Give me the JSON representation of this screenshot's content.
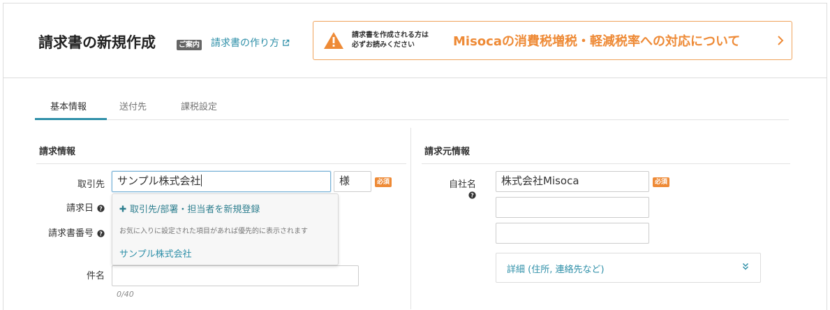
{
  "header": {
    "title": "請求書の新規作成",
    "guide_badge": "ご案内",
    "howto_link": "請求書の作り方",
    "notice_small_line1": "請求書を作成される方は",
    "notice_small_line2": "必ずお読みください",
    "notice_big": "Misocaの消費税増税・軽減税率への対応について"
  },
  "tabs": [
    {
      "label": "基本情報",
      "active": true
    },
    {
      "label": "送付先",
      "active": false
    },
    {
      "label": "課税設定",
      "active": false
    }
  ],
  "billing": {
    "section_title": "請求情報",
    "client_label": "取引先",
    "client_value": "サンプル株式会社",
    "honorific_value": "様",
    "required_badge": "必須",
    "date_label": "請求日",
    "number_label": "請求書番号",
    "subject_label": "件名",
    "subject_value": "",
    "subject_counter": "0/40"
  },
  "dropdown": {
    "add_new": "取引先/部署・担当者を新規登録",
    "note": "お気に入りに設定された項目があれば優先的に表示されます",
    "items": [
      "サンプル株式会社"
    ]
  },
  "issuer": {
    "section_title": "請求元情報",
    "company_label": "自社名",
    "company_value": "株式会社Misoca",
    "required_badge": "必須",
    "line2_value": "",
    "line3_value": "",
    "detail_toggle": "詳細 (住所, 連絡先など)"
  },
  "colors": {
    "accent": "#2e8fa8",
    "warning": "#ee8a36",
    "required": "#ee8a36"
  },
  "icons": {
    "external_link": "external-link-icon",
    "warning": "warning-icon",
    "chevron_right": "chevron-right-icon",
    "help": "help-icon",
    "plus": "plus-icon",
    "double_chevron_down": "double-chevron-down-icon"
  }
}
